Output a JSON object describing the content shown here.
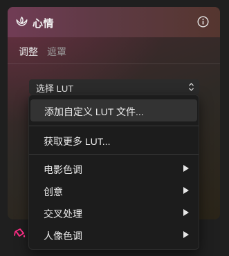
{
  "panel": {
    "title": "心情",
    "tabs": [
      {
        "label": "调整",
        "active": true
      },
      {
        "label": "遮罩",
        "active": false
      }
    ]
  },
  "icons": {
    "title_icon": "lotus-icon",
    "info": "info-icon",
    "select_indicator": "up-down-chevron-icon",
    "submenu": "triangle-right-icon",
    "bottom_tool": "paint-bucket-icon"
  },
  "colors": {
    "header_accent": "#713c55",
    "bucket_accent": "#ff2d86",
    "menu_bg": "#1c1c1c",
    "menu_highlight": "#333333"
  },
  "lut_select": {
    "label": "选择 LUT"
  },
  "menu": {
    "items": [
      {
        "label": "添加自定义 LUT 文件...",
        "submenu": false,
        "highlighted": true
      },
      {
        "label": "获取更多 LUT...",
        "submenu": false,
        "highlighted": false
      },
      {
        "label": "电影色调",
        "submenu": true,
        "highlighted": false
      },
      {
        "label": "创意",
        "submenu": true,
        "highlighted": false
      },
      {
        "label": "交叉处理",
        "submenu": true,
        "highlighted": false
      },
      {
        "label": "人像色调",
        "submenu": true,
        "highlighted": false
      }
    ]
  }
}
